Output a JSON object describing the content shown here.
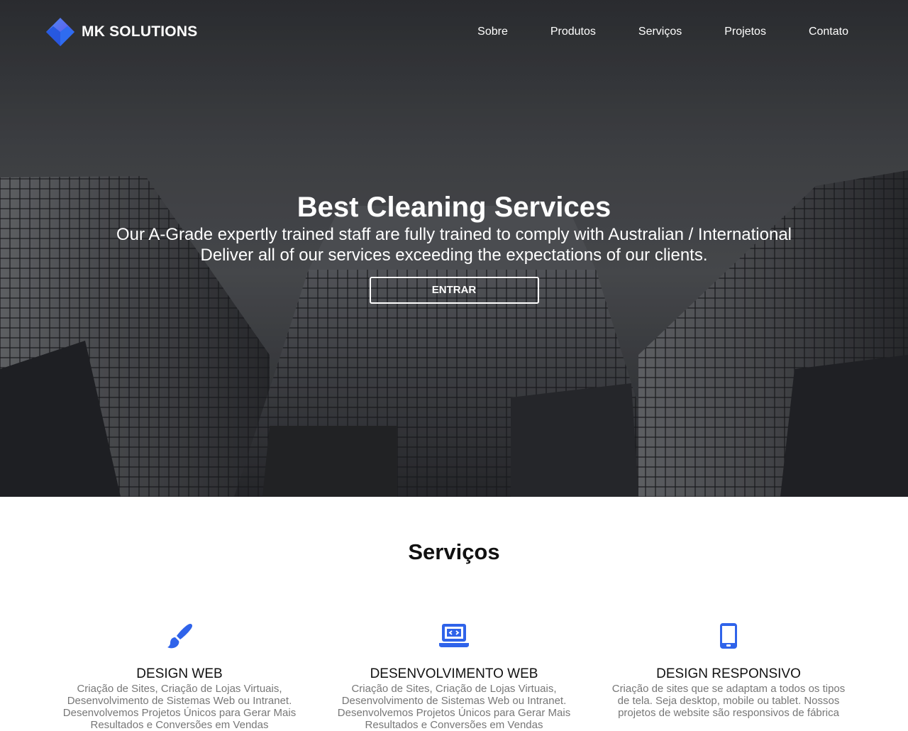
{
  "brand": {
    "name": "MK SOLUTIONS",
    "accent": "#2f63ea"
  },
  "nav": {
    "items": [
      "Sobre",
      "Produtos",
      "Serviços",
      "Projetos",
      "Contato"
    ]
  },
  "hero": {
    "title": "Best Cleaning Services",
    "line1": "Our A-Grade expertly trained staff are fully trained to comply with Australian / International",
    "line2": "Deliver all of our services exceeding the expectations of our clients.",
    "button": "ENTRAR"
  },
  "services": {
    "title": "Serviços",
    "cards": [
      {
        "icon": "paintbrush-icon",
        "title": "DESIGN WEB",
        "text": "Criação de Sites, Criação de Lojas Virtuais, Desenvolvimento de Sistemas Web ou Intranet. Desenvolvemos Projetos Únicos para Gerar Mais Resultados e Conversões em Vendas"
      },
      {
        "icon": "laptop-code-icon",
        "title": "DESENVOLVIMENTO WEB",
        "text": "Criação de Sites, Criação de Lojas Virtuais, Desenvolvimento de Sistemas Web ou Intranet. Desenvolvemos Projetos Únicos para Gerar Mais Resultados e Conversões em Vendas"
      },
      {
        "icon": "mobile-icon",
        "title": "DESIGN RESPONSIVO",
        "text": "Criação de sites que se adaptam a todos os tipos de tela. Seja desktop, mobile ou tablet. Nossos projetos de website são responsivos de fábrica"
      }
    ]
  }
}
